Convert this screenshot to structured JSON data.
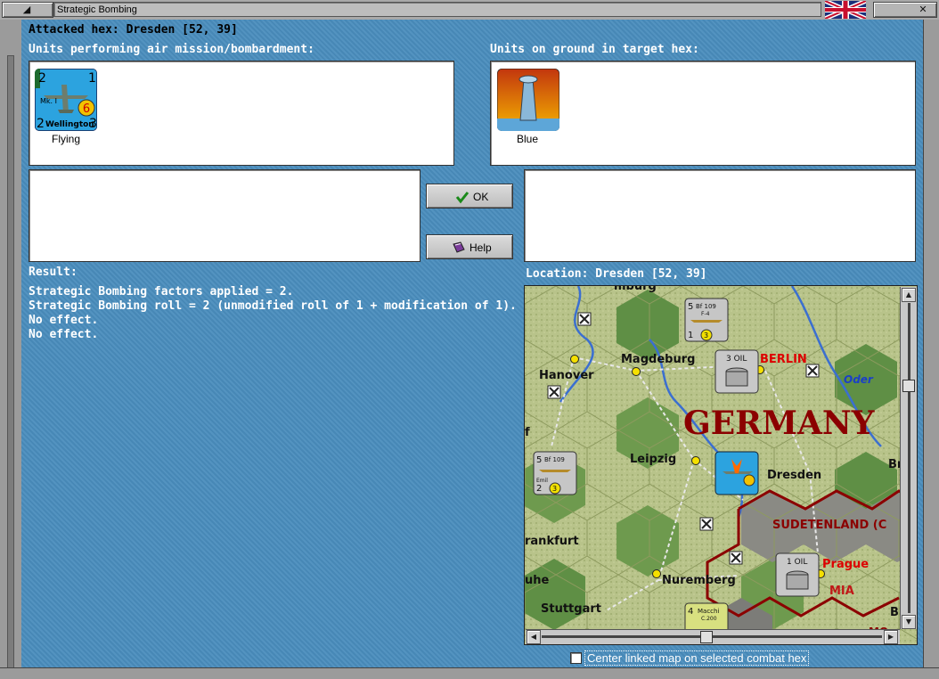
{
  "window": {
    "title": "Strategic Bombing"
  },
  "header": {
    "attacked_hex": "Attacked hex: Dresden  [52, 39]"
  },
  "air_units": {
    "label": "Units performing air mission/bombardment:",
    "units": [
      {
        "caption": "Flying",
        "counter_name": "Wellington",
        "counter_type": "Mk. I",
        "values": [
          "2",
          "1",
          "2",
          "3"
        ],
        "badge": "6",
        "color": "#2ca3df"
      }
    ]
  },
  "ground_units": {
    "label": "Units on ground in target hex:",
    "units": [
      {
        "caption": "Blue",
        "icon": "factory-icon"
      }
    ]
  },
  "buttons": {
    "ok": "OK",
    "help": "Help"
  },
  "result": {
    "label": "Result:",
    "lines": [
      "Strategic Bombing factors applied = 2.",
      "Strategic Bombing roll = 2 (unmodified roll of 1 + modification of 1).",
      "No effect.",
      "No effect."
    ]
  },
  "location": {
    "label": "Location:  Dresden  [52, 39]"
  },
  "map": {
    "country_label": "GERMANY",
    "region_label": "SUDETENLAND (C",
    "region_label2": "MIA",
    "cities": {
      "hamburg": "mburg",
      "magdeburg": "Magdeburg",
      "berlin": "BERLIN",
      "hanover": "Hanover",
      "oder": "Oder",
      "leipzig": "Leipzig",
      "dresden": "Dresden",
      "breslau": "Bres",
      "frankfurt": "rankfurt",
      "prague": "Prague",
      "nuremberg": "Nuremberg",
      "stuttgart": "Stuttgart",
      "uhe": "uhe",
      "f": "f",
      "b": "B",
      "mo": "MO"
    },
    "counters": [
      {
        "type": "Bf 109",
        "sub": "F-4",
        "attack": "5",
        "defense": "1",
        "move": "3"
      },
      {
        "type": "Bf 109",
        "sub": "Emil",
        "attack": "5",
        "defense": "2",
        "move": "3"
      },
      {
        "type": "Macchi",
        "sub": "C.200",
        "attack": "4",
        "defense": "",
        "move": ""
      }
    ],
    "oil": [
      "3 OIL",
      "1 OIL"
    ]
  },
  "options": {
    "center_map": "Center linked map on selected combat hex"
  },
  "colors": {
    "panel": "#4a8dbd",
    "accent_red": "#8b0000"
  }
}
